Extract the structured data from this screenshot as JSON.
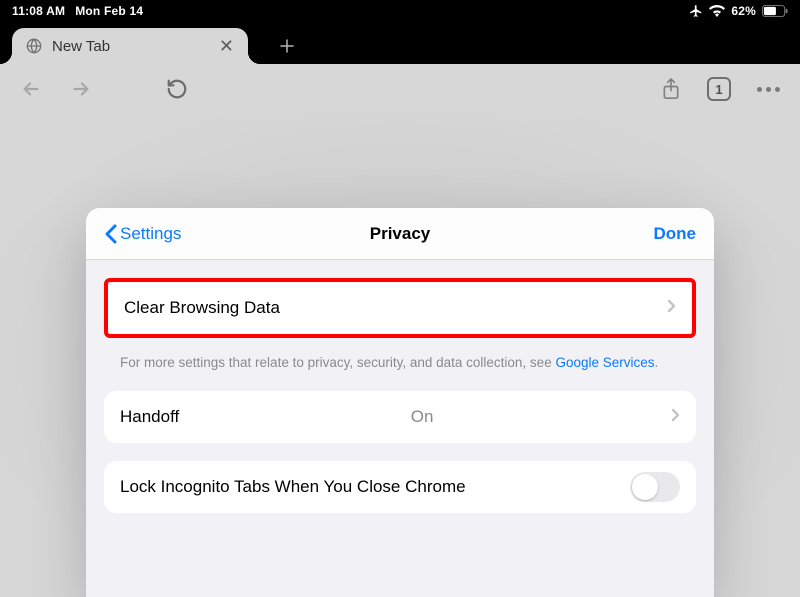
{
  "status": {
    "time": "11:08 AM",
    "date": "Mon Feb 14",
    "battery_pct": "62%"
  },
  "tab": {
    "title": "New Tab"
  },
  "toolbar": {
    "tab_count": "1"
  },
  "modal": {
    "back_label": "Settings",
    "title": "Privacy",
    "done_label": "Done",
    "rows": {
      "clear_browsing_data": "Clear Browsing Data",
      "handoff_label": "Handoff",
      "handoff_value": "On",
      "lock_incognito_label": "Lock Incognito Tabs When You Close Chrome"
    },
    "footer_prefix": "For more settings that relate to privacy, security, and data collection, see ",
    "footer_link": "Google Services",
    "footer_suffix": "."
  }
}
